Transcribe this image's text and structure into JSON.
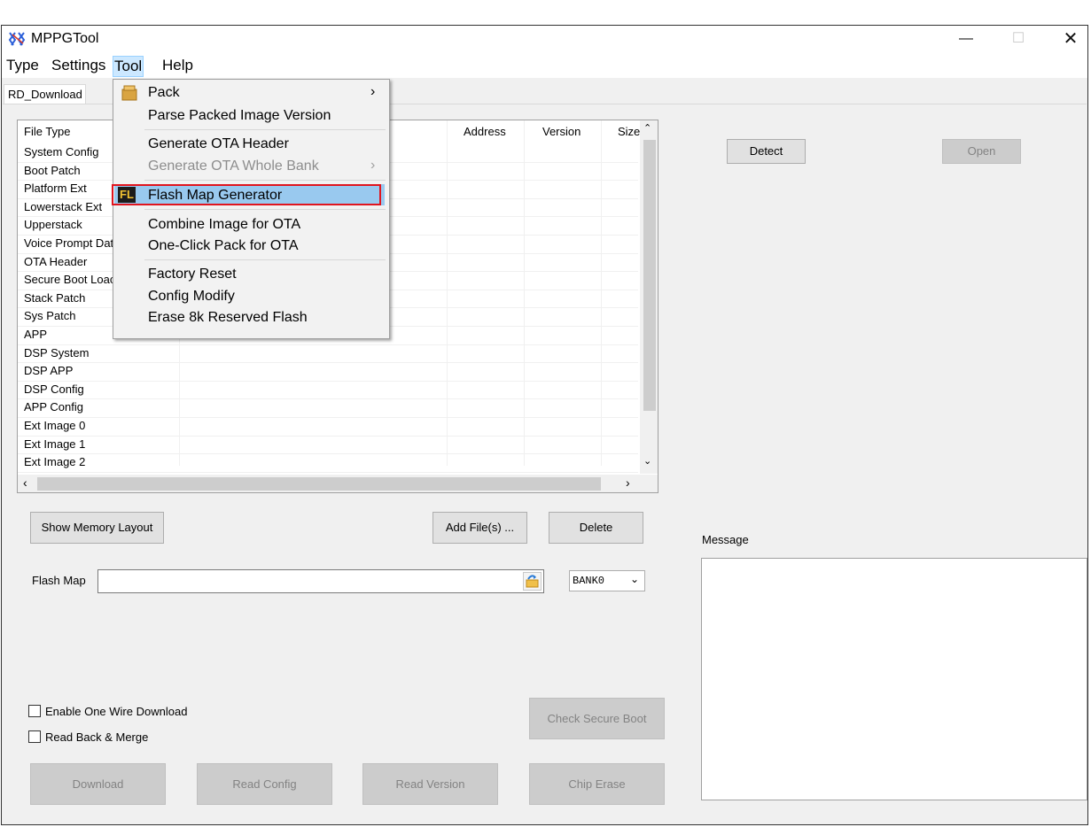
{
  "window": {
    "title": "MPPGTool"
  },
  "menubar": {
    "items": [
      "Type",
      "Settings",
      "Tool",
      "Help"
    ]
  },
  "tab": {
    "label": "RD_Download"
  },
  "file_list": {
    "columns": [
      "File Type",
      "Address",
      "Version",
      "Size"
    ],
    "rows": [
      "System Config",
      "Boot Patch",
      "Platform Ext",
      "Lowerstack Ext",
      "Upperstack",
      "Voice Prompt Dat",
      "OTA Header",
      "Secure Boot Loac",
      "Stack Patch",
      "Sys Patch",
      "APP",
      "DSP System",
      "DSP APP",
      "DSP Config",
      "APP Config",
      "Ext Image 0",
      "Ext Image 1",
      "Ext Image 2"
    ]
  },
  "tool_menu": {
    "items": [
      "Pack",
      "Parse Packed Image Version",
      "Generate OTA Header",
      "Generate OTA Whole Bank",
      "Flash Map Generator",
      "Combine Image for OTA",
      "One-Click Pack for OTA",
      "Factory Reset",
      "Config Modify",
      "Erase 8k Reserved Flash"
    ]
  },
  "buttons": {
    "detect": "Detect",
    "open": "Open",
    "show_memory_layout": "Show Memory Layout",
    "add_files": "Add File(s) ...",
    "delete": "Delete",
    "check_secure_boot": "Check Secure Boot",
    "download": "Download",
    "read_config": "Read Config",
    "read_version": "Read Version",
    "chip_erase": "Chip Erase"
  },
  "flash_map": {
    "label": "Flash Map",
    "value": "",
    "bank": "BANK0"
  },
  "options": {
    "enable_one_wire": "Enable One Wire Download",
    "read_back_merge": "Read Back & Merge"
  },
  "message": {
    "label": "Message"
  },
  "colors": {
    "highlight": "#99c9ef",
    "highlight_border": "#e0141e",
    "menu_active": "#cce8ff"
  }
}
